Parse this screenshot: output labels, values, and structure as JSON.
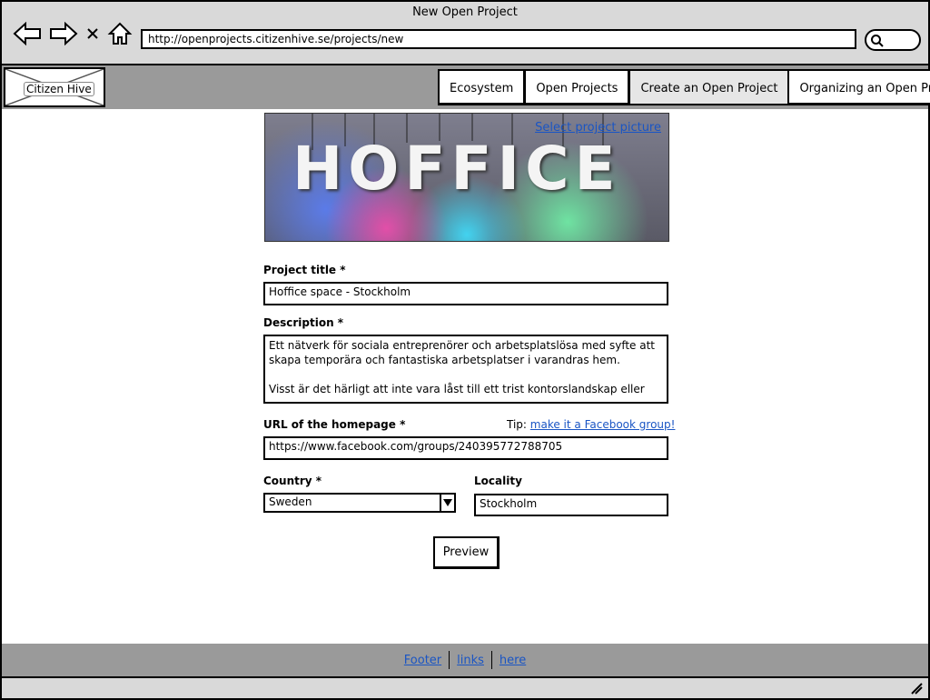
{
  "window": {
    "title": "New Open Project"
  },
  "browser": {
    "url": "http://openprojects.citizenhive.se/projects/new",
    "icons": [
      "back-arrow-icon",
      "forward-arrow-icon",
      "close-icon",
      "home-icon",
      "search-icon"
    ]
  },
  "header": {
    "logo_text": "Citizen Hive",
    "tabs": [
      {
        "label": "Ecosystem",
        "active": false
      },
      {
        "label": "Open Projects",
        "active": false
      },
      {
        "label": "Create an Open Project",
        "active": true
      },
      {
        "label": "Organizing an Open Project",
        "active": false
      }
    ]
  },
  "hero": {
    "image_text": "HOFFICE",
    "select_picture_link": "Select project picture"
  },
  "form": {
    "title_label": "Project title *",
    "title_value": "Hoffice space - Stockholm",
    "description_label": "Description *",
    "description_value": "Ett nätverk för sociala entreprenörer och arbetsplatslösa med syfte att\nskapa temporära och fantastiska arbetsplatser i varandras hem.\n\nVisst är det härligt att inte vara låst till ett trist kontorslandskap eller",
    "url_label": "URL of the homepage *",
    "tip_prefix": "Tip:",
    "tip_link": "make it a Facebook group!",
    "url_value": "https://www.facebook.com/groups/240395772788705",
    "country_label": "Country *",
    "country_value": "Sweden",
    "locality_label": "Locality",
    "locality_value": "Stockholm",
    "preview_button": "Preview"
  },
  "footer": {
    "links": [
      "Footer",
      "links",
      "here"
    ]
  }
}
